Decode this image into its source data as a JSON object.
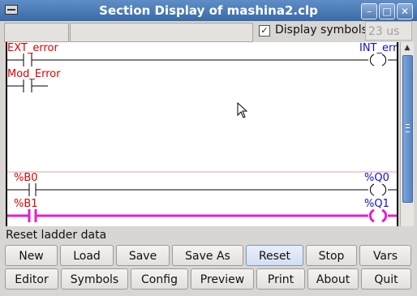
{
  "window": {
    "title": "Section Display of mashina2.clp",
    "controls": [
      "minimize-icon",
      "maximize-icon",
      "close-icon"
    ]
  },
  "toolbar": {
    "display_symbols_label": "Display symbols",
    "display_symbols_checked": true,
    "cycle_time": "23 us"
  },
  "ladder": {
    "rungs": [
      {
        "contacts": [
          "EXT_error",
          "Mod_Error"
        ],
        "coil": "INT_errt",
        "active": false
      },
      {
        "contacts": [
          "%B0"
        ],
        "coil": "%Q0",
        "active": false
      },
      {
        "contacts": [
          "%B1"
        ],
        "coil": "%Q1",
        "active": true
      }
    ],
    "colors": {
      "contact_label": "#e00000",
      "coil_label": "#1010d0",
      "active_rung": "#e020d0",
      "rung_line": "#000000"
    }
  },
  "status": {
    "text": "Reset ladder data"
  },
  "buttons": {
    "row1": [
      "New",
      "Load",
      "Save",
      "Save As",
      "Reset",
      "Stop",
      "Vars"
    ],
    "row2": [
      "Editor",
      "Symbols",
      "Config",
      "Preview",
      "Print",
      "About",
      "Quit"
    ]
  }
}
